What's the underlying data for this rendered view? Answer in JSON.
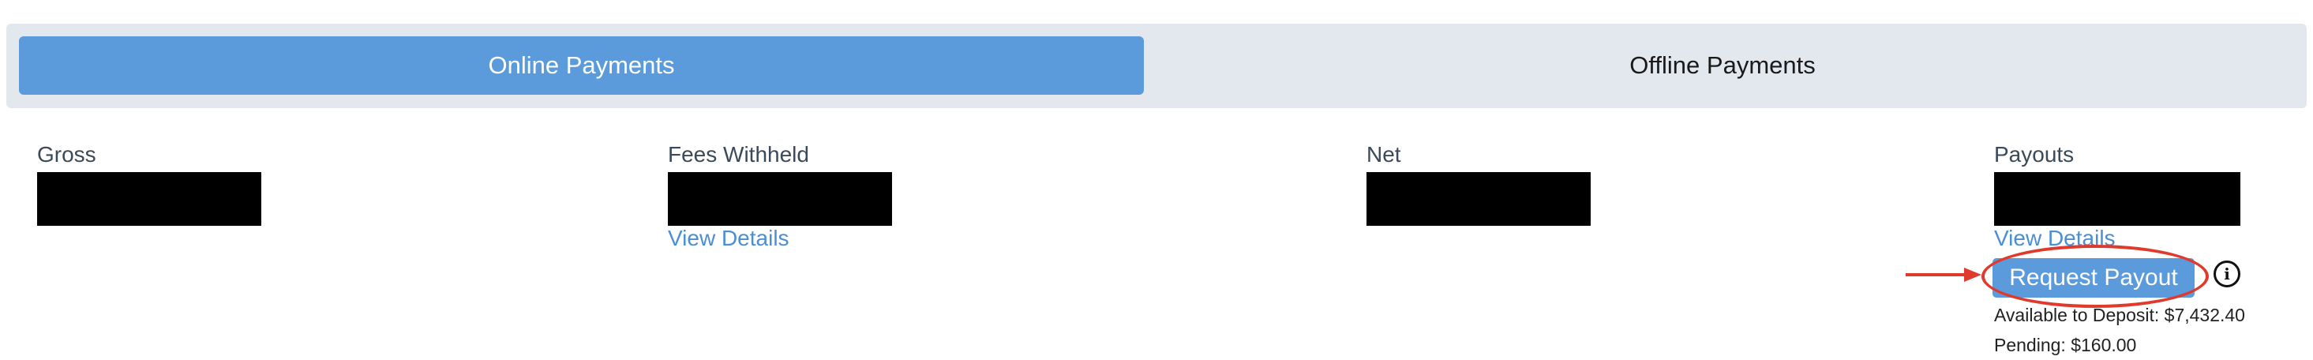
{
  "tabs": {
    "online": "Online Payments",
    "offline": "Offline Payments"
  },
  "stats": {
    "gross": {
      "label": "Gross"
    },
    "fees": {
      "label": "Fees Withheld",
      "link": "View Details"
    },
    "net": {
      "label": "Net"
    },
    "payouts": {
      "label": "Payouts",
      "link": "View Details"
    }
  },
  "payout": {
    "button_label": "Request Payout",
    "info_icon": "i",
    "available": "Available to Deposit: $7,432.40",
    "pending": "Pending: $160.00"
  },
  "annotation": {
    "color": "#e03a2c"
  },
  "colors": {
    "accent": "#5b9bdc",
    "link": "#4a8fd6",
    "tab_bg": "#e3e7ee"
  }
}
